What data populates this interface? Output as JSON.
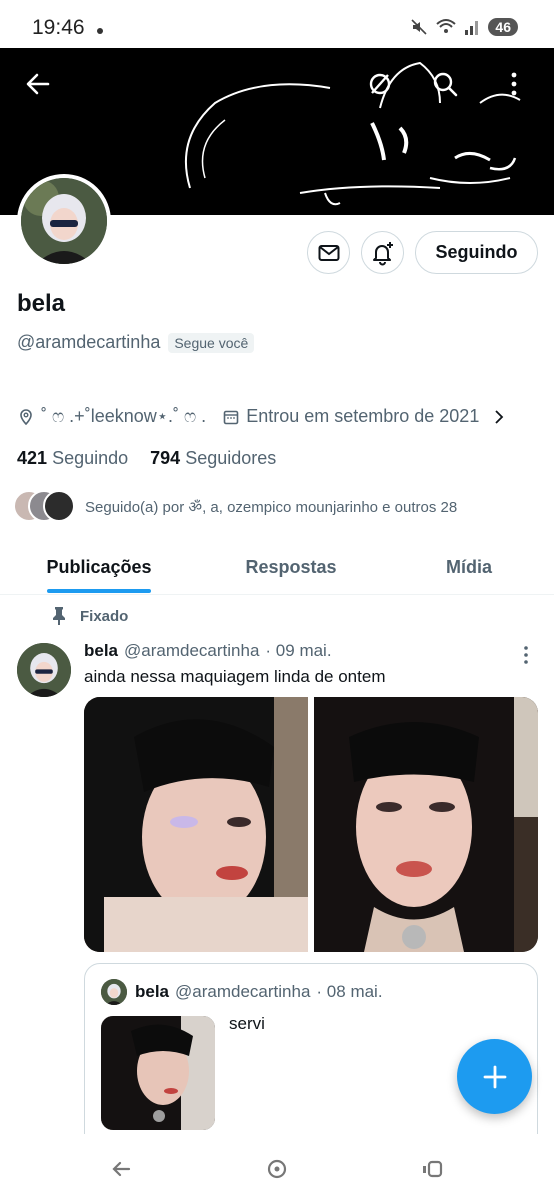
{
  "status_bar": {
    "time": "19:46",
    "battery": "46"
  },
  "profile": {
    "name": "bela",
    "handle": "@aramdecartinha",
    "follows_you": "Segue você",
    "location": "˚ ෆ .+˚leeknow⋆.˚ ෆ .",
    "joined": "Entrou em setembro de 2021",
    "following_count": "421",
    "following_label": "Seguindo",
    "followers_count": "794",
    "followers_label": "Seguidores",
    "followed_by": "Seguido(a) por ॐ, a, ozempico mounjarinho e outros 28",
    "follow_button": "Seguindo"
  },
  "tabs": [
    {
      "label": "Publicações"
    },
    {
      "label": "Respostas"
    },
    {
      "label": "Mídia"
    }
  ],
  "pinned_label": "Fixado",
  "post": {
    "name": "bela",
    "handle": "@aramdecartinha",
    "date": "· 09 mai.",
    "text": "ainda nessa maquiagem linda de ontem"
  },
  "quote": {
    "name": "bela",
    "handle": "@aramdecartinha",
    "date": "· 08 mai.",
    "text": "servi"
  },
  "colors": {
    "accent": "#1d9bf0",
    "banner": "#000000",
    "muted": "#536471"
  },
  "icons": [
    "back-arrow-icon",
    "no-translate-icon",
    "search-icon",
    "more-vertical-icon",
    "mail-icon",
    "bell-plus-icon",
    "location-pin-icon",
    "calendar-icon",
    "chevron-right-icon",
    "pin-icon",
    "plus-icon"
  ]
}
